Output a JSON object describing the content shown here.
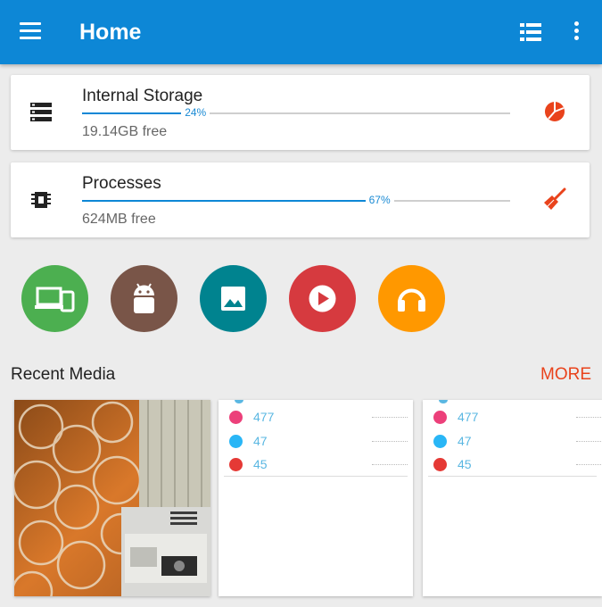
{
  "appbar": {
    "title": "Home",
    "menu_icon": "hamburger-menu-icon",
    "list_icon": "list-view-icon",
    "overflow_icon": "more-vert-icon",
    "color": "#0d87d6"
  },
  "storage": {
    "label": "Internal Storage",
    "percent_text": "24%",
    "percent": 24,
    "free": "19.14GB free",
    "icon": "storage-icon",
    "action_icon": "pie-chart-icon"
  },
  "processes": {
    "label": "Processes",
    "percent_text": "67%",
    "percent": 67,
    "free": "624MB free",
    "icon": "cpu-chip-icon",
    "action_icon": "clean-broom-icon"
  },
  "shortcuts": [
    {
      "name": "devices-icon",
      "color": "#4caf50"
    },
    {
      "name": "android-icon",
      "color": "#795548"
    },
    {
      "name": "image-icon",
      "color": "#00838f"
    },
    {
      "name": "video-play-icon",
      "color": "#d63a3f"
    },
    {
      "name": "headphones-icon",
      "color": "#ff9800"
    }
  ],
  "recent": {
    "title": "Recent Media",
    "more": "MORE"
  },
  "media_panels": [
    {
      "rows": [
        {
          "value": "477",
          "color": "#ec407a"
        },
        {
          "value": "47",
          "color": "#29b6f6"
        },
        {
          "value": "45",
          "color": "#e53935"
        }
      ]
    },
    {
      "rows": [
        {
          "value": "477",
          "color": "#ec407a"
        },
        {
          "value": "47",
          "color": "#29b6f6"
        },
        {
          "value": "45",
          "color": "#e53935"
        }
      ]
    }
  ]
}
